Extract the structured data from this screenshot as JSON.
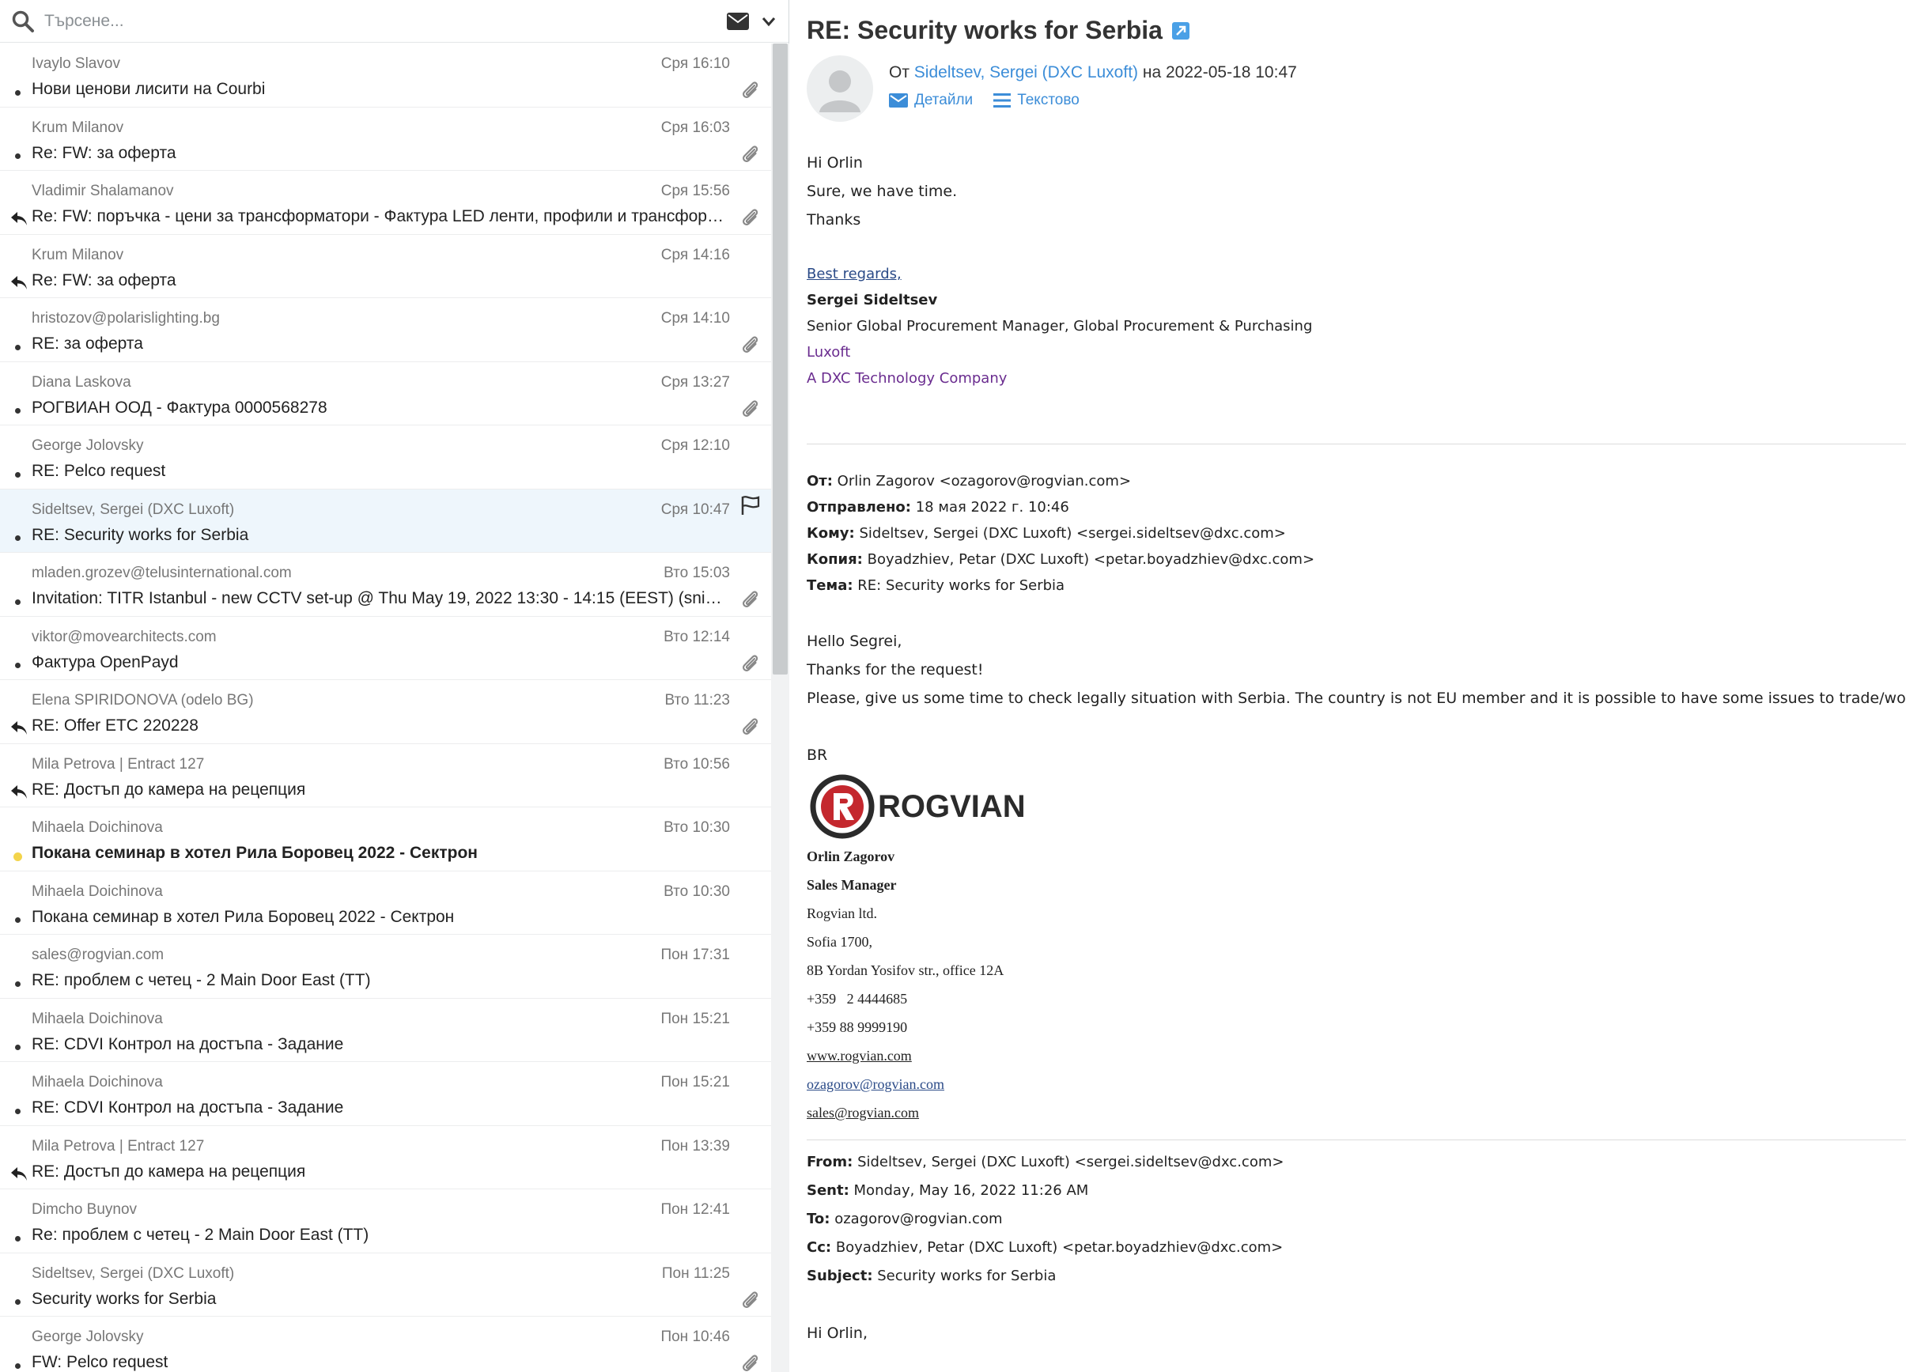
{
  "search": {
    "placeholder": "Търсене..."
  },
  "colors": {
    "accent": "#3c8dd8",
    "selected_bg": "#eef6fc",
    "unread_dot": "#f3d44b",
    "sig_purple": "#6a2c8f"
  },
  "messages": [
    {
      "from": "Ivaylo Slavov",
      "date": "Сря 16:10",
      "subject": "Нови ценови лисити на Courbi",
      "status": "dot",
      "attachment": true
    },
    {
      "from": "Krum Milanov",
      "date": "Сря 16:03",
      "subject": "Re: FW: за оферта",
      "status": "dot",
      "attachment": true
    },
    {
      "from": "Vladimir Shalamanov",
      "date": "Сря 15:56",
      "subject": "Re: FW: поръчка - цени за трансформатори - Фактура LED ленти, профили и трансформаторите",
      "status": "replied",
      "attachment": true
    },
    {
      "from": "Krum Milanov",
      "date": "Сря 14:16",
      "subject": "Re: FW: за оферта",
      "status": "replied",
      "attachment": false
    },
    {
      "from": "hristozov@polarislighting.bg",
      "date": "Сря 14:10",
      "subject": "RE: за оферта",
      "status": "dot",
      "attachment": true
    },
    {
      "from": "Diana Laskova",
      "date": "Сря 13:27",
      "subject": "РОГВИАН ООД - Фактура 0000568278",
      "status": "dot",
      "attachment": true
    },
    {
      "from": "George Jolovsky",
      "date": "Сря 12:10",
      "subject": "RE: Pelco request",
      "status": "dot",
      "attachment": false
    },
    {
      "from": "Sideltsev, Sergei (DXC Luxoft)",
      "date": "Сря 10:47",
      "subject": "RE: Security works for Serbia",
      "status": "dot",
      "attachment": false,
      "flag": true,
      "selected": true
    },
    {
      "from": "mladen.grozev@telusinternational.com",
      "date": "Вто 15:03",
      "subject": "Invitation: TITR Istanbul - new CCTV set-up @ Thu May 19, 2022 13:30 - 14:15 (EEST) (snikolov@rogvian.com)",
      "status": "dot",
      "attachment": true
    },
    {
      "from": "viktor@movearchitects.com",
      "date": "Вто 12:14",
      "subject": "Фактура OpenPayd",
      "status": "dot",
      "attachment": true
    },
    {
      "from": "Elena SPIRIDONOVA (odelo BG)",
      "date": "Вто 11:23",
      "subject": "RE: Offer ETC 220228",
      "status": "replied",
      "attachment": true
    },
    {
      "from": "Mila Petrova | Entract 127",
      "date": "Вто 10:56",
      "subject": "RE: Достъп до камера на рецепция",
      "status": "replied",
      "attachment": false
    },
    {
      "from": "Mihaela Doichinova",
      "date": "Вто 10:30",
      "subject": "Покана семинар в хотел Рила Боровец 2022 - Сектрон",
      "status": "unread",
      "attachment": false
    },
    {
      "from": "Mihaela Doichinova",
      "date": "Вто 10:30",
      "subject": "Покана семинар в хотел Рила Боровец 2022 - Сектрон",
      "status": "dot",
      "attachment": false
    },
    {
      "from": "sales@rogvian.com",
      "date": "Пон 17:31",
      "subject": "RE: проблем с четец - 2 Main Door East (TT)",
      "status": "dot",
      "attachment": false
    },
    {
      "from": "Mihaela Doichinova",
      "date": "Пон 15:21",
      "subject": "RE: CDVI Контрол на достъпа - Задание",
      "status": "dot",
      "attachment": false
    },
    {
      "from": "Mihaela Doichinova",
      "date": "Пон 15:21",
      "subject": "RE: CDVI Контрол на достъпа - Задание",
      "status": "dot",
      "attachment": false
    },
    {
      "from": "Mila Petrova | Entract 127",
      "date": "Пон 13:39",
      "subject": "RE: Достъп до камера на рецепция",
      "status": "replied",
      "attachment": false
    },
    {
      "from": "Dimcho Buynov",
      "date": "Пон 12:41",
      "subject": "Re: проблем с четец - 2 Main Door East (TT)",
      "status": "dot",
      "attachment": false
    },
    {
      "from": "Sideltsev, Sergei (DXC Luxoft)",
      "date": "Пон 11:25",
      "subject": "Security works for Serbia",
      "status": "dot",
      "attachment": true
    },
    {
      "from": "George Jolovsky",
      "date": "Пон 10:46",
      "subject": "FW: Pelco request",
      "status": "dot",
      "attachment": true
    }
  ],
  "view": {
    "subject": "RE: Security works for Serbia",
    "from_prefix": "От",
    "from_name": "Sideltsev, Sergei (DXC Luxoft)",
    "date_prefix": "на",
    "date": "2022-05-18 10:47",
    "details_label": "Детайли",
    "text_label": "Текстово",
    "body_lines": [
      "Hi Orlin",
      "Sure, we have time.",
      "Thanks"
    ],
    "sig": {
      "regards": "Best regards,",
      "name": "Sergei Sideltsev",
      "title": "Senior Global Procurement Manager, Global Procurement & Purchasing",
      "company": "Luxoft",
      "company2": "A DXC Technology Company"
    },
    "quote1": {
      "from_label": "От:",
      "from": "Orlin Zagorov <ozagorov@rogvian.com>",
      "sent_label": "Отправлено:",
      "sent": "18 мая 2022 г. 10:46",
      "to_label": "Кому:",
      "to": "Sideltsev, Sergei (DXC Luxoft) <sergei.sideltsev@dxc.com>",
      "cc_label": "Копия:",
      "cc": "Boyadzhiev, Petar (DXC Luxoft) <petar.boyadzhiev@dxc.com>",
      "subj_label": "Тема:",
      "subj": "RE: Security works for Serbia"
    },
    "quote1_body": [
      "Hello Segrei,",
      "Thanks for the request!",
      "Please, give us some time to check legally situation with Serbia. The country is not EU member and it is possible to have some issues to trade/work there."
    ],
    "br": "BR",
    "logo_text": "ROGVIAN",
    "sig2": {
      "name": "Orlin Zagorov",
      "role": "Sales Manager",
      "company": "Rogvian ltd.",
      "city": "Sofia 1700,",
      "address": "8B Yordan Yosifov str., office 12A",
      "phone1": "+359   2 4444685",
      "phone2": "+359 88 9999190",
      "web": "www.rogvian.com",
      "email1": "ozagorov@rogvian.com",
      "email2": "sales@rogvian.com"
    },
    "quote2": {
      "from_label": "From:",
      "from": "Sideltsev, Sergei (DXC Luxoft) <sergei.sideltsev@dxc.com>",
      "sent_label": "Sent:",
      "sent": "Monday, May 16, 2022 11:26 AM",
      "to_label": "To:",
      "to": "ozagorov@rogvian.com",
      "cc_label": "Cc:",
      "cc": "Boyadzhiev, Petar (DXC Luxoft) <petar.boyadzhiev@dxc.com>",
      "subj_label": "Subject:",
      "subj": "Security works for Serbia"
    },
    "quote2_body_first": "Hi Orlin,"
  }
}
